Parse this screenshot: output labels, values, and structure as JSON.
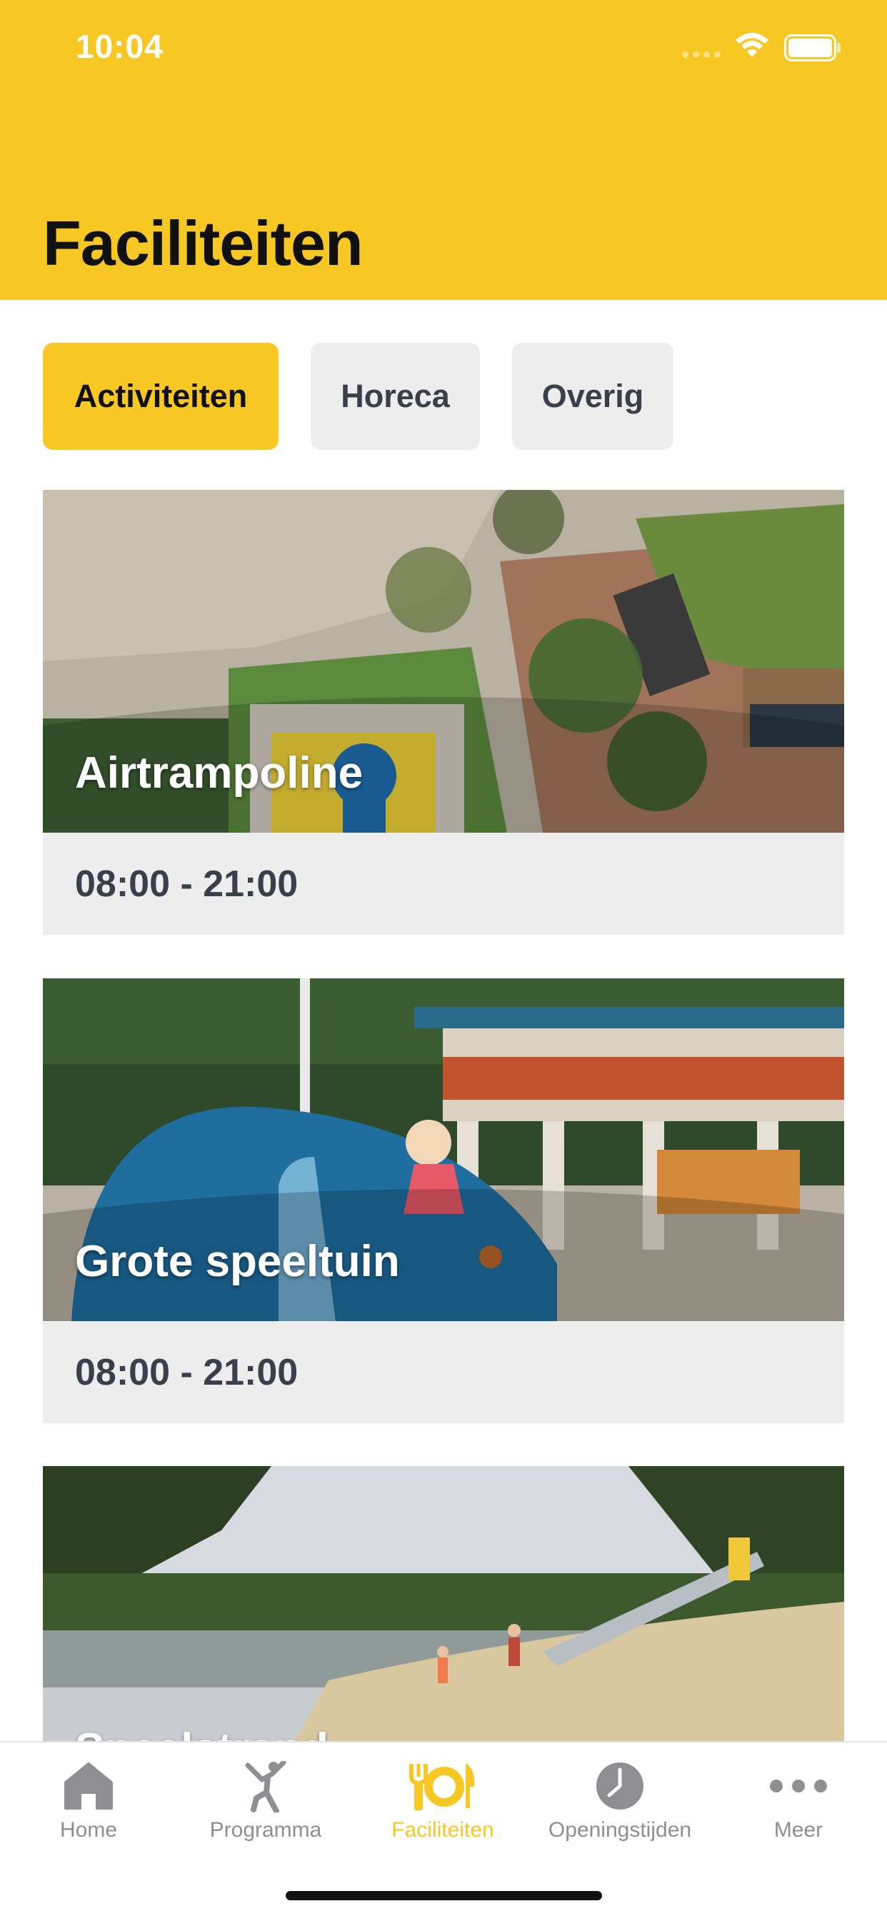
{
  "status_bar": {
    "time": "10:04"
  },
  "header": {
    "title": "Faciliteiten"
  },
  "filter_tabs": [
    {
      "label": "Activiteiten",
      "active": true
    },
    {
      "label": "Horeca",
      "active": false
    },
    {
      "label": "Overig",
      "active": false
    }
  ],
  "cards": [
    {
      "title": "Airtrampoline",
      "hours": "08:00 - 21:00"
    },
    {
      "title": "Grote speeltuin",
      "hours": "08:00 - 21:00"
    },
    {
      "title": "Speelstrand",
      "hours": ""
    }
  ],
  "tab_bar": {
    "items": [
      {
        "label": "Home",
        "icon": "home-icon",
        "active": false
      },
      {
        "label": "Programma",
        "icon": "person-jumping-icon",
        "active": false
      },
      {
        "label": "Faciliteiten",
        "icon": "fork-plate-knife-icon",
        "active": true
      },
      {
        "label": "Openingstijden",
        "icon": "clock-icon",
        "active": false
      },
      {
        "label": "Meer",
        "icon": "more-dots-icon",
        "active": false
      }
    ]
  },
  "colors": {
    "accent": "#F7C824",
    "tab_inactive_bg": "#EDEDED",
    "text_dark": "#3a3f4c",
    "tab_bar_inactive": "#8e8e93"
  }
}
